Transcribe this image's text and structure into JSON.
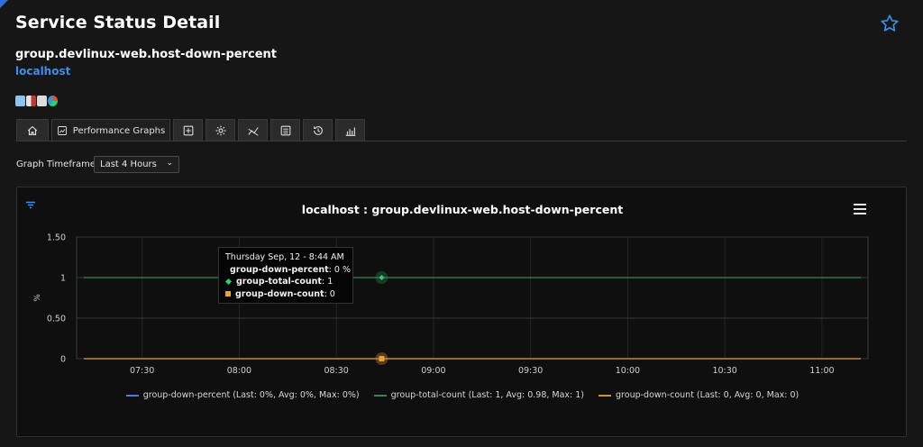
{
  "page": {
    "title": "Service Status Detail",
    "service_name": "group.devlinux-web.host-down-percent",
    "host": "localhost"
  },
  "tabs": [
    {
      "name": "home",
      "icon": "home-icon"
    },
    {
      "name": "performance-graphs",
      "label": "Performance Graphs",
      "icon": "line-chart-icon",
      "active": true
    },
    {
      "name": "add",
      "icon": "plus-square-icon"
    },
    {
      "name": "settings",
      "icon": "gear-icon"
    },
    {
      "name": "trends",
      "icon": "trend-icon"
    },
    {
      "name": "log",
      "icon": "list-icon"
    },
    {
      "name": "history",
      "icon": "history-icon"
    },
    {
      "name": "histogram",
      "icon": "histogram-icon"
    }
  ],
  "timeframe": {
    "label": "Graph Timeframe:",
    "selected": "Last 4 Hours"
  },
  "colors": {
    "down_percent": "#4a7fd6",
    "total_count": "#2e8b57",
    "down_count": "#d9903a",
    "accent": "#3b8ef0"
  },
  "chart_data": {
    "type": "line",
    "title": "localhost : group.devlinux-web.host-down-percent",
    "ylabel": "%",
    "ylim": [
      0,
      1.5
    ],
    "yticks": [
      "0",
      "0.50",
      "1",
      "1.50"
    ],
    "xticks": [
      "07:30",
      "08:00",
      "08:30",
      "09:00",
      "09:30",
      "10:00",
      "10:30",
      "11:00"
    ],
    "x_range": [
      "07:12",
      "11:12"
    ],
    "series": [
      {
        "name": "group-down-percent",
        "values": [
          0,
          0
        ],
        "x": [
          "07:12",
          "11:12"
        ],
        "legend": "group-down-percent (Last: 0%, Avg: 0%, Max: 0%)"
      },
      {
        "name": "group-total-count",
        "values": [
          1,
          1
        ],
        "x": [
          "07:12",
          "11:12"
        ],
        "legend": "group-total-count (Last: 1, Avg: 0.98, Max: 1)"
      },
      {
        "name": "group-down-count",
        "values": [
          0,
          0
        ],
        "x": [
          "07:12",
          "11:12"
        ],
        "legend": "group-down-count (Last: 0, Avg: 0, Max: 0)"
      }
    ],
    "tooltip": {
      "header": "Thursday Sep, 12 - 8:44 AM",
      "time": "08:44",
      "rows": [
        {
          "name": "group-down-percent",
          "value": "0 %"
        },
        {
          "name": "group-total-count",
          "value": "1"
        },
        {
          "name": "group-down-count",
          "value": "0"
        }
      ]
    }
  }
}
